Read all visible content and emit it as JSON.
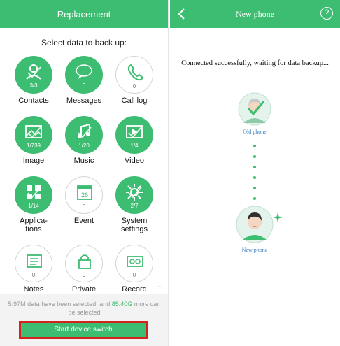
{
  "left_screen": {
    "title": "Replacement",
    "subtitle": "Select data to back up:",
    "items": [
      {
        "label": "Contacts",
        "count": "3/3",
        "selected": true,
        "icon": "contact-icon"
      },
      {
        "label": "Messages",
        "count": "0",
        "selected": true,
        "icon": "message-icon"
      },
      {
        "label": "Call log",
        "count": "0",
        "selected": false,
        "icon": "phone-icon"
      },
      {
        "label": "Image",
        "count": "1/739",
        "selected": true,
        "icon": "image-icon"
      },
      {
        "label": "Music",
        "count": "1/20",
        "selected": true,
        "icon": "music-icon"
      },
      {
        "label": "Video",
        "count": "1/4",
        "selected": true,
        "icon": "video-icon"
      },
      {
        "label": "Applica-\ntions",
        "count": "1/14",
        "selected": true,
        "icon": "app-icon"
      },
      {
        "label": "Event",
        "count": "0",
        "selected": false,
        "icon": "calendar-icon"
      },
      {
        "label": "System\nsettings",
        "count": "2/7",
        "selected": true,
        "icon": "settings-icon"
      },
      {
        "label": "Notes",
        "count": "0",
        "selected": false,
        "icon": "notes-icon"
      },
      {
        "label": "Private",
        "count": "0",
        "selected": false,
        "icon": "lock-icon"
      },
      {
        "label": "Record",
        "count": "0",
        "selected": false,
        "icon": "recorder-icon"
      }
    ],
    "summary_prefix": "5.97M data have been selected, and ",
    "summary_accent": "85.40G",
    "summary_suffix": " more can be selected",
    "button_label": "Start device switch"
  },
  "right_screen": {
    "title": "New phone",
    "help_glyph": "?",
    "status": "Connected successfully, waiting for data backup...",
    "old_phone_label": "Old phone",
    "new_phone_label": "New phone"
  },
  "colors": {
    "accent": "#3dbd71",
    "highlight_border": "#d3231e",
    "link_blue": "#3d7fc4"
  }
}
